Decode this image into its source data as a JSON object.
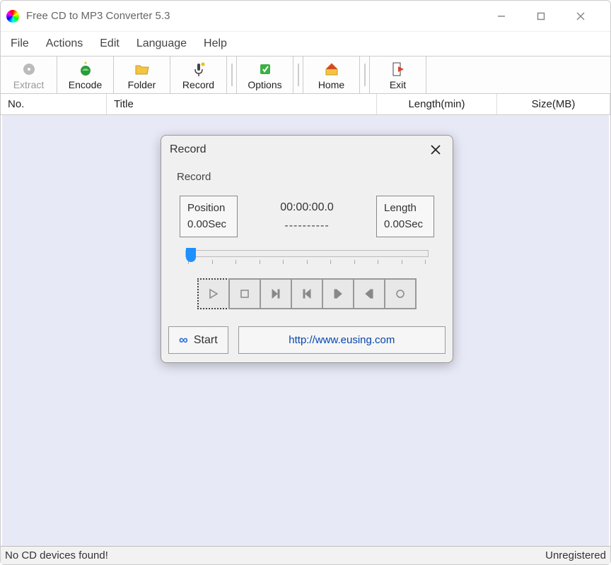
{
  "window": {
    "title": "Free CD to MP3 Converter 5.3"
  },
  "menu": {
    "file": "File",
    "actions": "Actions",
    "edit": "Edit",
    "language": "Language",
    "help": "Help"
  },
  "toolbar": {
    "extract": "Extract",
    "encode": "Encode",
    "folder": "Folder",
    "record": "Record",
    "options": "Options",
    "home": "Home",
    "exit": "Exit"
  },
  "table": {
    "no": "No.",
    "title": "Title",
    "length": "Length(min)",
    "size": "Size(MB)"
  },
  "status": {
    "left": "No CD devices found!",
    "right": "Unregistered"
  },
  "dialog": {
    "title": "Record",
    "group": "Record",
    "position_label": "Position",
    "position_value": "0.00Sec",
    "time": "00:00:00.0",
    "dots": "----------",
    "length_label": "Length",
    "length_value": "0.00Sec",
    "start": "Start",
    "link": "http://www.eusing.com"
  }
}
